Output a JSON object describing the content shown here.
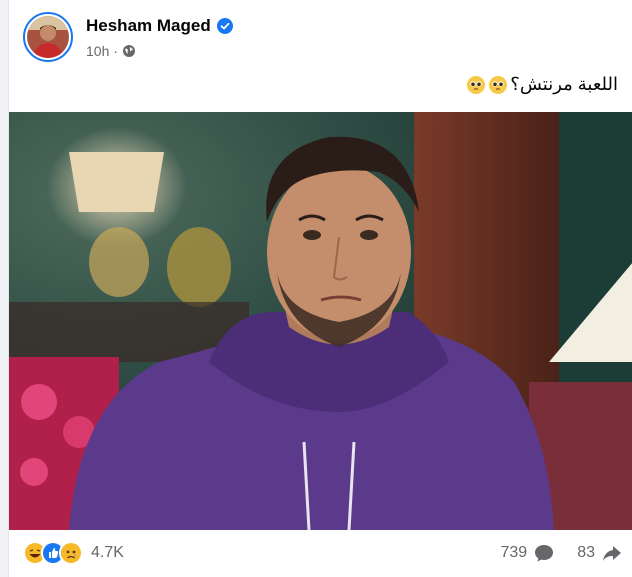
{
  "post": {
    "author_name": "Hesham Maged",
    "time": "10h",
    "separator": "·",
    "caption_text": "اللعبة مرنتش؟",
    "caption_emoji": [
      "pleading-face",
      "pleading-face"
    ]
  },
  "engagement": {
    "reaction_icons": [
      "laughing-emoji",
      "like-emoji",
      "sad-emoji"
    ],
    "reaction_count": "4.7K",
    "comment_count": "739",
    "share_count": "83"
  },
  "colors": {
    "accent": "#1877f2",
    "secondary_text": "#65676b",
    "primary_text": "#050505",
    "hoodie": "#5b3a8c"
  }
}
